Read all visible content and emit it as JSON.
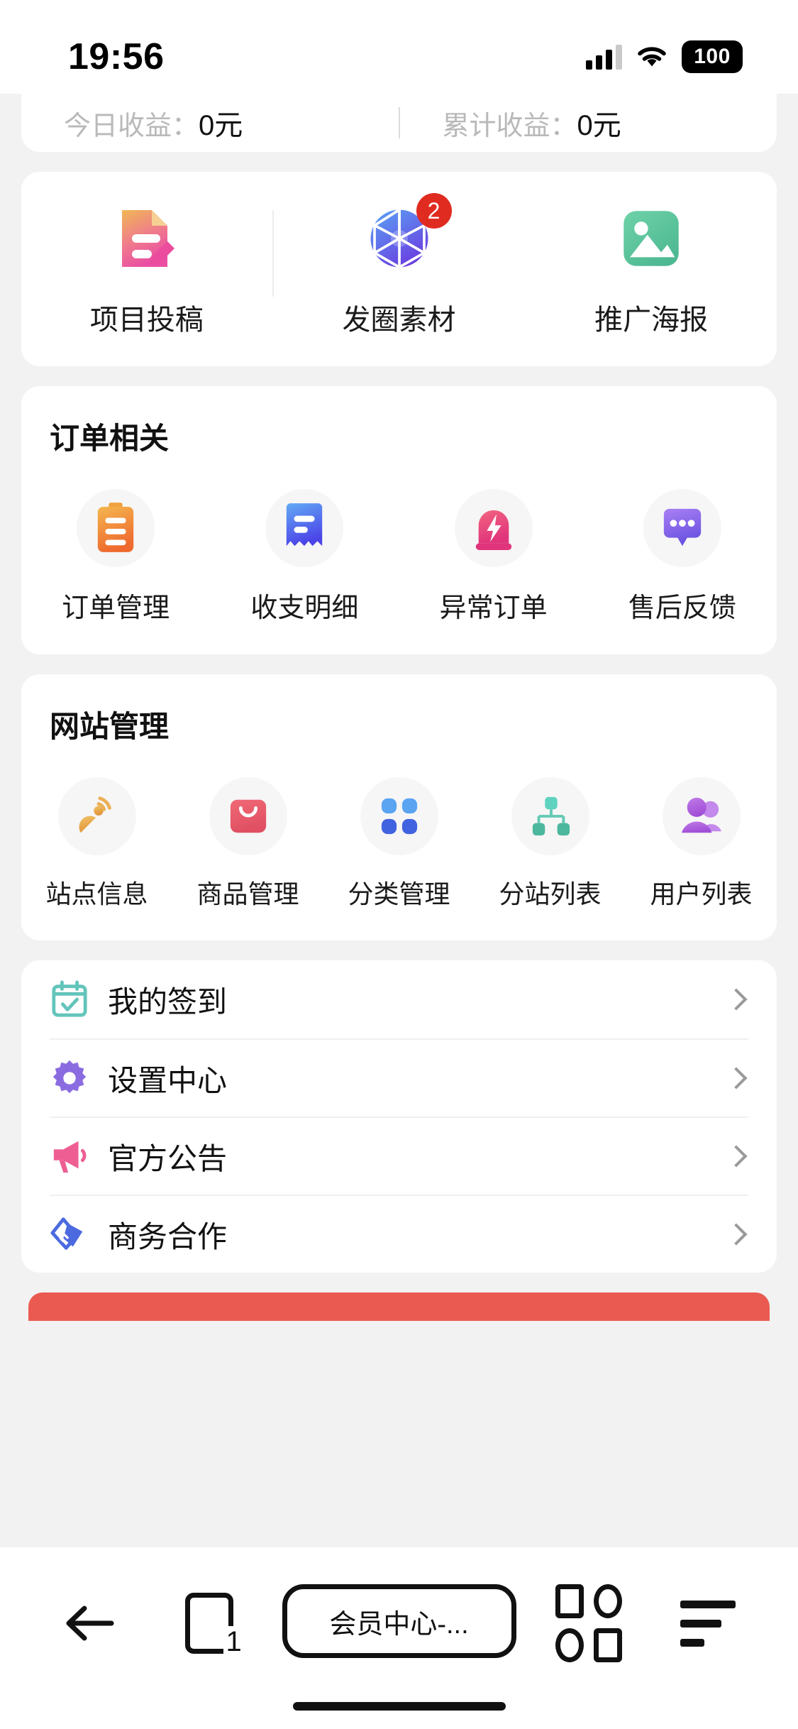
{
  "status_bar": {
    "time": "19:56",
    "battery": "100",
    "signal_icon": "cellular-signal-icon",
    "wifi_icon": "wifi-icon",
    "battery_icon": "battery-icon"
  },
  "earnings": {
    "today_label": "今日收益：",
    "today_value": "0元",
    "total_label": "累计收益：",
    "total_value": "0元"
  },
  "shortcuts": {
    "items": [
      {
        "label": "项目投稿",
        "icon": "document-edit-icon",
        "badge": ""
      },
      {
        "label": "发圈素材",
        "icon": "aperture-icon",
        "badge": "2"
      },
      {
        "label": "推广海报",
        "icon": "image-picture-icon",
        "badge": ""
      }
    ]
  },
  "order_section": {
    "title": "订单相关",
    "items": [
      {
        "label": "订单管理",
        "icon": "clipboard-list-icon",
        "color": "#f0902f"
      },
      {
        "label": "收支明细",
        "icon": "receipt-icon",
        "color": "#4c6ef0"
      },
      {
        "label": "异常订单",
        "icon": "alarm-siren-icon",
        "color": "#ea4f7c"
      },
      {
        "label": "售后反馈",
        "icon": "chat-bubble-icon",
        "color": "#8b6cf0"
      }
    ]
  },
  "site_section": {
    "title": "网站管理",
    "items": [
      {
        "label": "站点信息",
        "icon": "satellite-dish-icon",
        "color": "#eda84a"
      },
      {
        "label": "商品管理",
        "icon": "shopping-bag-icon",
        "color": "#ec5c6e"
      },
      {
        "label": "分类管理",
        "icon": "grid-dots-icon",
        "color": "#4a8ef0"
      },
      {
        "label": "分站列表",
        "icon": "sitemap-icon",
        "color": "#52c4ac"
      },
      {
        "label": "用户列表",
        "icon": "users-icon",
        "color": "#b271e0"
      }
    ]
  },
  "menu_list": {
    "items": [
      {
        "label": "我的签到",
        "icon": "calendar-check-icon",
        "color": "#63c4bb",
        "chevron": "chevron-right-icon"
      },
      {
        "label": "设置中心",
        "icon": "gear-icon",
        "color": "#8b6ce0",
        "chevron": "chevron-right-icon"
      },
      {
        "label": "官方公告",
        "icon": "megaphone-icon",
        "color": "#ee5e93",
        "chevron": "chevron-right-icon"
      },
      {
        "label": "商务合作",
        "icon": "handshake-icon",
        "color": "#4c6ae0",
        "chevron": "chevron-right-icon"
      }
    ]
  },
  "bottom_bar": {
    "back_icon": "back-arrow-icon",
    "tab_count": "1",
    "tab_icon": "tabs-icon",
    "url_label": "会员中心-...",
    "apps_icon": "apps-grid-icon",
    "menu_icon": "menu-lines-icon"
  },
  "colors": {
    "page_bg": "#f2f2f2",
    "card_bg": "#ffffff",
    "badge_red": "#e02b20",
    "accent_strip": "#ea5a50"
  }
}
